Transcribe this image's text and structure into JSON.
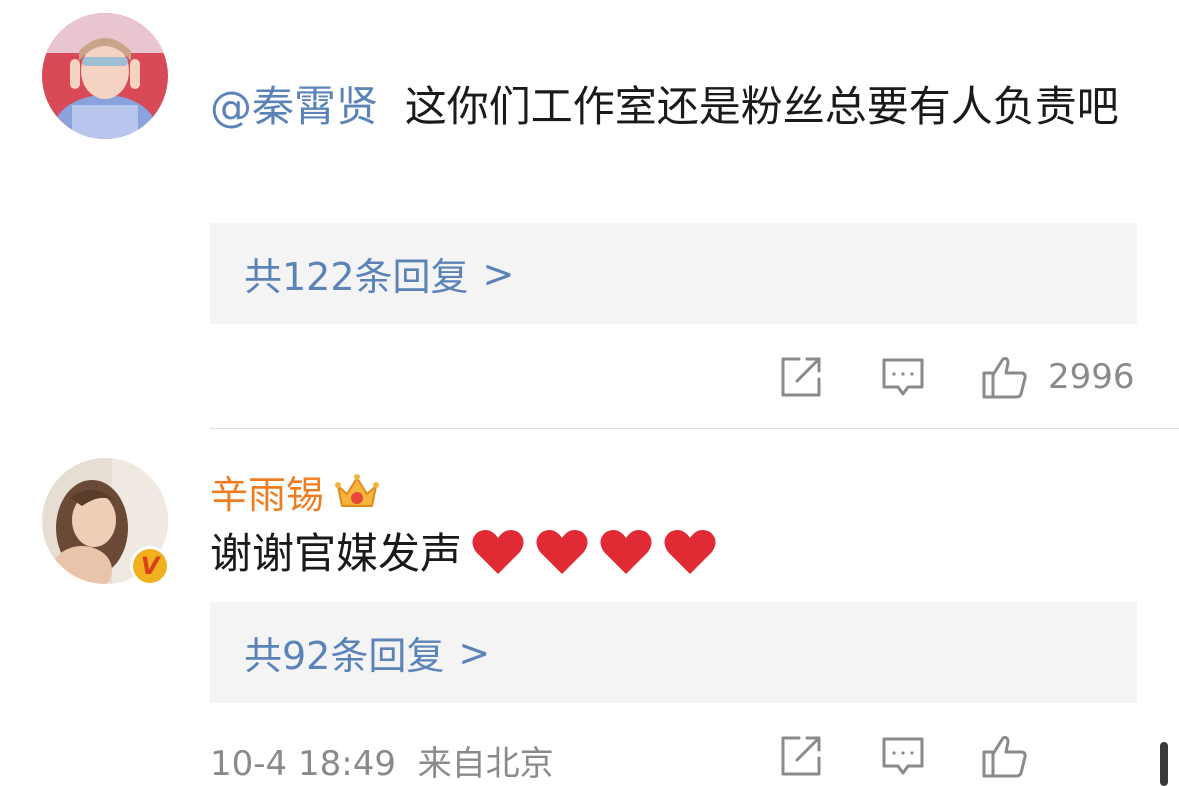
{
  "comment1": {
    "mention": "@秦霄贤",
    "text": "这你们工作室还是粉丝总要有人负责吧",
    "replies": "共122条回复",
    "replies_chevron": ">",
    "likes": "2996"
  },
  "comment2": {
    "username": "辛雨锡",
    "text": "谢谢官媒发声",
    "replies": "共92条回复",
    "replies_chevron": ">",
    "timestamp": "10-4 18:49",
    "location": "来自北京",
    "verified_badge": "V"
  },
  "icons": [
    "share-icon",
    "comment-icon",
    "like-icon",
    "crown-icon",
    "heart-icon"
  ],
  "colors": {
    "link": "#5b83b8",
    "username_vip": "#ee7d22",
    "reply_bg": "#f4f4f4",
    "meta": "#8a8a8a",
    "heart": "#e02b35"
  }
}
